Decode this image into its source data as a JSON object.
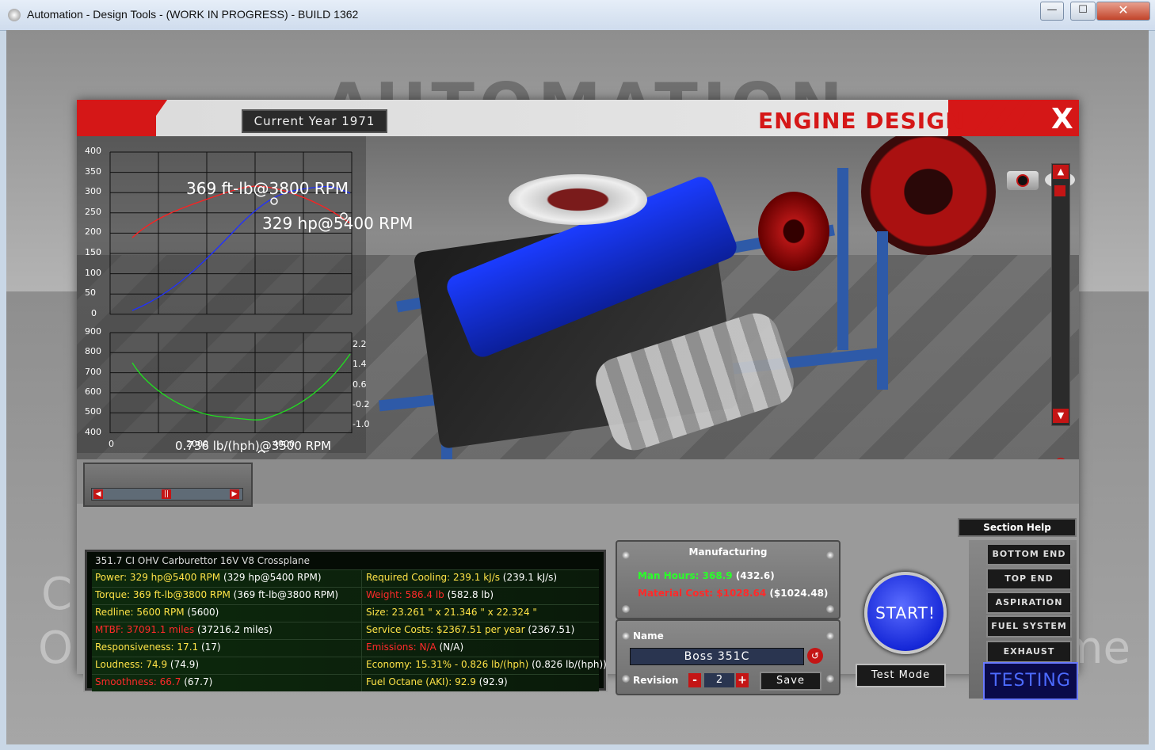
{
  "window": {
    "title": "Automation - Design Tools - (WORK IN PROGRESS) - BUILD 1362",
    "min_label": "—",
    "max_label": "☐",
    "close_label": "✕"
  },
  "header": {
    "year": "Current Year 1971",
    "title": "ENGINE DESIGN",
    "close": "X"
  },
  "background": {
    "logo": "AUTOMATION",
    "left_text_1": "C",
    "left_text_2": "O",
    "right_text": "me"
  },
  "graph": {
    "torque_peak": "369 ft-lb@3800 RPM",
    "power_peak": "329 hp@5400 RPM",
    "economy_peak": "0.736 lb/(hph)@3500 RPM",
    "top_y_ticks": [
      "400",
      "350",
      "300",
      "250",
      "200",
      "150",
      "100",
      "50",
      "0"
    ],
    "bottom_y_ticks": [
      "900",
      "800",
      "700",
      "600",
      "500",
      "400"
    ],
    "right_ticks": [
      "2.2",
      "1.4",
      "0.6",
      "-0.2",
      "-1.0"
    ],
    "x_ticks": [
      "0",
      "2000",
      "4000"
    ]
  },
  "scroll": {
    "up": "▲",
    "down": "▼"
  },
  "mini": {
    "left": "◀",
    "mid": "||",
    "right": "▶"
  },
  "section_help": "Section Help",
  "specs": {
    "title": "351.7 CI OHV Carburettor 16V V8 Crossplane",
    "rows": [
      {
        "l_label": "Power: 329 hp@5400 RPM",
        "l_extra": " (329 hp@5400 RPM)",
        "r_label": "Required Cooling: 239.1 kJ/s",
        "r_extra": " (239.1 kJ/s)"
      },
      {
        "l_label": "Torque: 369 ft-lb@3800 RPM",
        "l_extra": " (369 ft-lb@3800 RPM)",
        "r_label": "Weight: 586.4 lb",
        "r_extra": " (582.8 lb)"
      },
      {
        "l_label": "Redline: 5600 RPM",
        "l_extra": " (5600)",
        "r_label": "Size: 23.261 \" x 21.346 \" x 22.324 \"",
        "r_extra": ""
      },
      {
        "l_label": "MTBF: 37091.1 miles",
        "l_extra": " (37216.2 miles)",
        "r_label": "Service Costs: $2367.51 per year",
        "r_extra": " (2367.51)"
      },
      {
        "l_label": "Responsiveness: 17.1",
        "l_extra": " (17)",
        "r_label": "Emissions: N/A",
        "r_extra": " (N/A)"
      },
      {
        "l_label": "Loudness: 74.9",
        "l_extra": " (74.9)",
        "r_label": "Economy: 15.31% - 0.826 lb/(hph)",
        "r_extra": " (0.826 lb/(hph))"
      },
      {
        "l_label": "Smoothness: 66.7",
        "l_extra": " (67.7)",
        "r_label": "Fuel Octane (AKI): 92.9",
        "r_extra": " (92.9)"
      }
    ]
  },
  "manufacturing": {
    "title": "Manufacturing",
    "man_hours": "Man Hours: 368.9",
    "man_hours_extra": " (432.6)",
    "material_cost": "Material Cost: $1028.64",
    "material_cost_extra": " ($1024.48)"
  },
  "name_panel": {
    "name_label": "Name",
    "name_value": "Boss 351C",
    "revision_label": "Revision",
    "revision_value": "2",
    "minus": "-",
    "plus": "+",
    "save": "Save",
    "reset": "↺"
  },
  "start": "START!",
  "test_mode": "Test Mode",
  "sections": [
    "BOTTOM END",
    "TOP END",
    "ASPIRATION",
    "FUEL SYSTEM",
    "EXHAUST"
  ],
  "testing": "TESTING",
  "colors": {
    "accent_red": "#d51717",
    "start_blue": "#1628d8",
    "torque": "#ff2020",
    "power": "#2030ff",
    "economy": "#20e020"
  }
}
